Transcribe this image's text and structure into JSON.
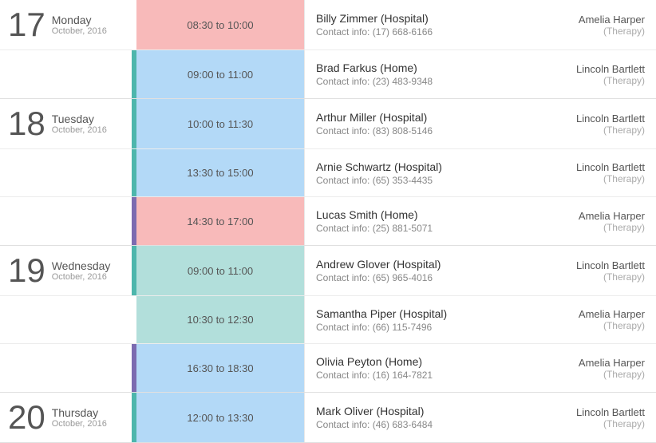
{
  "days": [
    {
      "number": "17",
      "name": "Monday",
      "month": "October, 2016",
      "events": [
        {
          "timeRange": "08:30 to 10:00",
          "timeColor": "pink",
          "barColor": "empty",
          "clientName": "Billy Zimmer (Hospital)",
          "contact": "Contact info: (17) 668-6166",
          "assignee": "Amelia Harper",
          "role": "(Therapy)"
        },
        {
          "timeRange": "09:00 to 11:00",
          "timeColor": "blue",
          "barColor": "teal",
          "clientName": "Brad Farkus (Home)",
          "contact": "Contact info: (23) 483-9348",
          "assignee": "Lincoln Bartlett",
          "role": "(Therapy)"
        }
      ]
    },
    {
      "number": "18",
      "name": "Tuesday",
      "month": "October, 2016",
      "events": [
        {
          "timeRange": "10:00 to 11:30",
          "timeColor": "blue",
          "barColor": "teal",
          "clientName": "Arthur Miller (Hospital)",
          "contact": "Contact info: (83) 808-5146",
          "assignee": "Lincoln Bartlett",
          "role": "(Therapy)"
        },
        {
          "timeRange": "13:30 to 15:00",
          "timeColor": "blue",
          "barColor": "teal",
          "clientName": "Arnie Schwartz (Hospital)",
          "contact": "Contact info: (65) 353-4435",
          "assignee": "Lincoln Bartlett",
          "role": "(Therapy)"
        },
        {
          "timeRange": "14:30 to 17:00",
          "timeColor": "pink",
          "barColor": "purple",
          "clientName": "Lucas Smith (Home)",
          "contact": "Contact info: (25) 881-5071",
          "assignee": "Amelia Harper",
          "role": "(Therapy)"
        }
      ]
    },
    {
      "number": "19",
      "name": "Wednesday",
      "month": "October, 2016",
      "events": [
        {
          "timeRange": "09:00 to 11:00",
          "timeColor": "green",
          "barColor": "teal",
          "clientName": "Andrew Glover (Hospital)",
          "contact": "Contact info: (65) 965-4016",
          "assignee": "Lincoln Bartlett",
          "role": "(Therapy)"
        },
        {
          "timeRange": "10:30 to 12:30",
          "timeColor": "green",
          "barColor": "empty",
          "clientName": "Samantha Piper (Hospital)",
          "contact": "Contact info: (66) 115-7496",
          "assignee": "Amelia Harper",
          "role": "(Therapy)"
        },
        {
          "timeRange": "16:30 to 18:30",
          "timeColor": "blue",
          "barColor": "purple",
          "clientName": "Olivia Peyton (Home)",
          "contact": "Contact info: (16) 164-7821",
          "assignee": "Amelia Harper",
          "role": "(Therapy)"
        }
      ]
    },
    {
      "number": "20",
      "name": "Thursday",
      "month": "October, 2016",
      "events": [
        {
          "timeRange": "12:00 to 13:30",
          "timeColor": "blue",
          "barColor": "teal",
          "clientName": "Mark Oliver (Hospital)",
          "contact": "Contact info: (46) 683-6484",
          "assignee": "Lincoln Bartlett",
          "role": "(Therapy)"
        }
      ]
    }
  ]
}
